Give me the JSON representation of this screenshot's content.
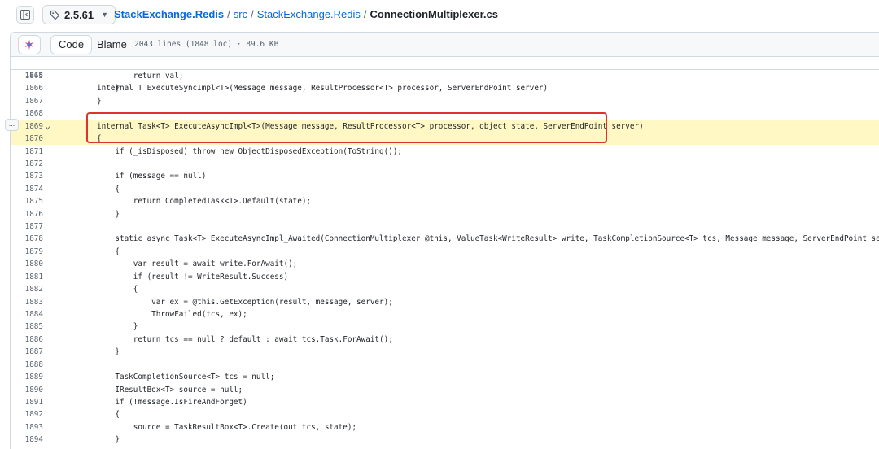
{
  "header": {
    "branch": "2.5.61",
    "repo": "StackExchange.Redis",
    "path1": "src",
    "path2": "StackExchange.Redis",
    "file": "ConnectionMultiplexer.cs",
    "sep": "/"
  },
  "filebar": {
    "code_tab": "Code",
    "blame_tab": "Blame",
    "meta": "2043 lines (1848 loc) · 89.6 KB"
  },
  "ellipsis": "...",
  "sticky": {
    "num": "1818",
    "code": "internal T ExecuteSyncImpl<T>(Message message, ResultProcessor<T> processor, ServerEndPoint server)"
  },
  "lines": [
    {
      "num": "1865",
      "code": "        return val;"
    },
    {
      "num": "1866",
      "code": "    }"
    },
    {
      "num": "1867",
      "code": "}"
    },
    {
      "num": "1868",
      "code": ""
    },
    {
      "num": "1869",
      "code": "internal Task<T> ExecuteAsyncImpl<T>(Message message, ResultProcessor<T> processor, object state, ServerEndPoint server)"
    },
    {
      "num": "1870",
      "code": "{"
    },
    {
      "num": "1871",
      "code": "    if (_isDisposed) throw new ObjectDisposedException(ToString());"
    },
    {
      "num": "1872",
      "code": ""
    },
    {
      "num": "1873",
      "code": "    if (message == null)"
    },
    {
      "num": "1874",
      "code": "    {"
    },
    {
      "num": "1875",
      "code": "        return CompletedTask<T>.Default(state);"
    },
    {
      "num": "1876",
      "code": "    }"
    },
    {
      "num": "1877",
      "code": ""
    },
    {
      "num": "1878",
      "code": "    static async Task<T> ExecuteAsyncImpl_Awaited(ConnectionMultiplexer @this, ValueTask<WriteResult> write, TaskCompletionSource<T> tcs, Message message, ServerEndPoint server)"
    },
    {
      "num": "1879",
      "code": "    {"
    },
    {
      "num": "1880",
      "code": "        var result = await write.ForAwait();"
    },
    {
      "num": "1881",
      "code": "        if (result != WriteResult.Success)"
    },
    {
      "num": "1882",
      "code": "        {"
    },
    {
      "num": "1883",
      "code": "            var ex = @this.GetException(result, message, server);"
    },
    {
      "num": "1884",
      "code": "            ThrowFailed(tcs, ex);"
    },
    {
      "num": "1885",
      "code": "        }"
    },
    {
      "num": "1886",
      "code": "        return tcs == null ? default : await tcs.Task.ForAwait();"
    },
    {
      "num": "1887",
      "code": "    }"
    },
    {
      "num": "1888",
      "code": ""
    },
    {
      "num": "1889",
      "code": "    TaskCompletionSource<T> tcs = null;"
    },
    {
      "num": "1890",
      "code": "    IResultBox<T> source = null;"
    },
    {
      "num": "1891",
      "code": "    if (!message.IsFireAndForget)"
    },
    {
      "num": "1892",
      "code": "    {"
    },
    {
      "num": "1893",
      "code": "        source = TaskResultBox<T>.Create(out tcs, state);"
    },
    {
      "num": "1894",
      "code": "    }"
    }
  ],
  "colors": {
    "highlight": "#fff8c5",
    "annotation": "#e03131",
    "link": "#0969da"
  }
}
